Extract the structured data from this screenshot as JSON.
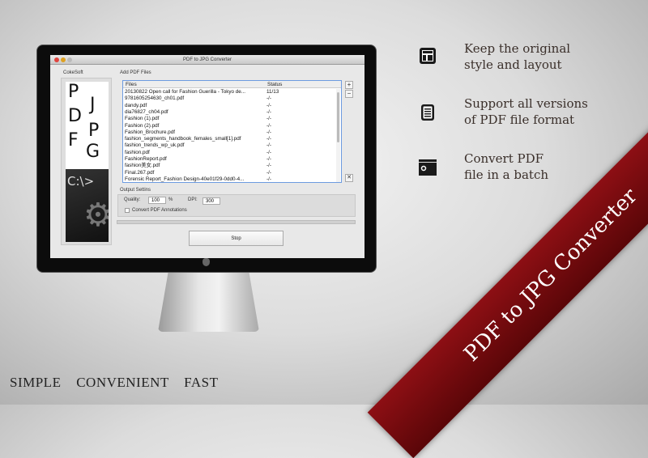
{
  "window": {
    "title": "PDF to JPG Converter"
  },
  "sidebar": {
    "brand": "CokeSoft",
    "art_letters": [
      "P",
      "J",
      "D",
      "P",
      "F",
      "G"
    ],
    "art_prompt": "C:\\>"
  },
  "files": {
    "section_label": "Add PDF Files",
    "columns": [
      "Files",
      "Status"
    ],
    "rows": [
      {
        "name": "20130822 Open call for Fashion Guerilla - Tokyo de...",
        "status": "11/13"
      },
      {
        "name": "9781605254630_ch01.pdf",
        "status": "-/-"
      },
      {
        "name": "dandy.pdf",
        "status": "-/-"
      },
      {
        "name": "dia76827_ch04.pdf",
        "status": "-/-"
      },
      {
        "name": "Fashion (1).pdf",
        "status": "-/-"
      },
      {
        "name": "Fashion (2).pdf",
        "status": "-/-"
      },
      {
        "name": "Fashion_Brochure.pdf",
        "status": "-/-"
      },
      {
        "name": "fashion_segments_handbook_females_small[1].pdf",
        "status": "-/-"
      },
      {
        "name": "fashion_trends_wp_uk.pdf",
        "status": "-/-"
      },
      {
        "name": "fashion.pdf",
        "status": "-/-"
      },
      {
        "name": "FashionReport.pdf",
        "status": "-/-"
      },
      {
        "name": "fashion美女.pdf",
        "status": "-/-"
      },
      {
        "name": "Final.267.pdf",
        "status": "-/-"
      },
      {
        "name": "Forensic Report_Fashion Design-40e01f29-0dd0-4...",
        "status": "-/-"
      }
    ],
    "add": "+",
    "remove": "−",
    "clear": "✕"
  },
  "settings": {
    "section_label": "Output Settins",
    "quality_label": "Quality:",
    "quality": "100",
    "percent": "%",
    "dpi_label": "DPI:",
    "dpi": "300",
    "annotations_label": "Convert PDF Annotations",
    "annotations_checked": false
  },
  "progress": {
    "value": 0
  },
  "stop_label": "Stop",
  "features": [
    {
      "icon": "layout-icon",
      "line1": "Keep the original",
      "line2": "style and layout"
    },
    {
      "icon": "document-icon",
      "line1": "Support all versions",
      "line2": "of PDF file format"
    },
    {
      "icon": "batch-window-icon",
      "line1": "Convert PDF",
      "line2": "file in a batch"
    }
  ],
  "tagline": "SIMPLE CONVENIENT FAST",
  "ribbon": "PDF to JPG Converter"
}
